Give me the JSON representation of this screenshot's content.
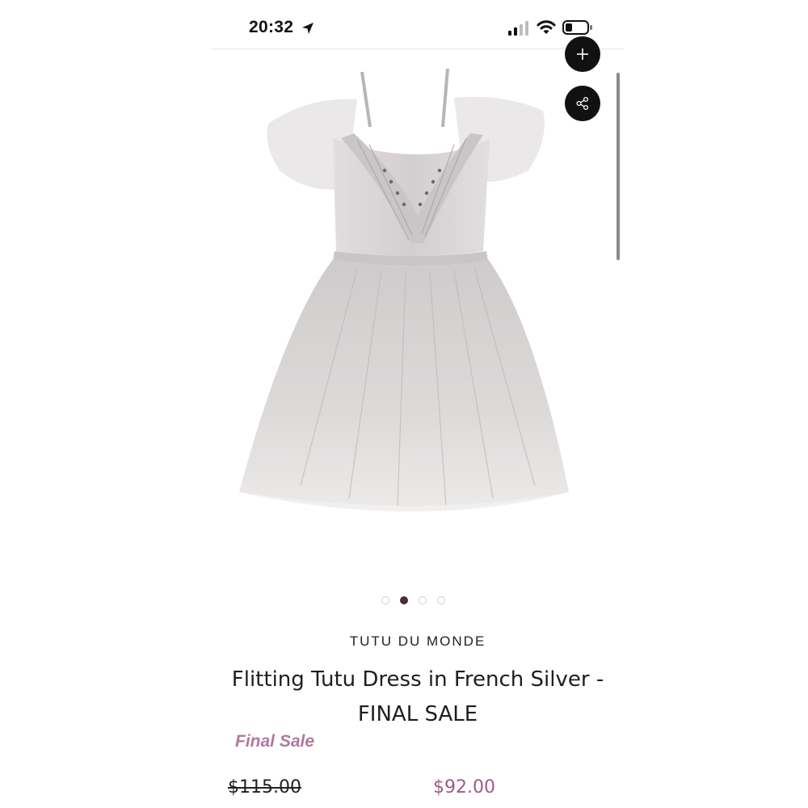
{
  "status_bar": {
    "time": "20:32",
    "icons": [
      "location-arrow-icon",
      "cellular-signal-icon",
      "wifi-icon",
      "battery-icon"
    ]
  },
  "product_media": {
    "image_subject": "grey tulle tutu dress",
    "actions": [
      "plus-icon",
      "share-icon"
    ],
    "carousel": {
      "total": 4,
      "active_index": 1
    }
  },
  "product": {
    "brand": "TUTU DU MONDE",
    "title": "Flitting Tutu Dress in French Silver - FINAL SALE",
    "sale_tag": "Final Sale",
    "original_price": "$115.00",
    "sale_price": "$92.00"
  },
  "colors": {
    "accent_purple": "#a05a86",
    "sale_tag_pink": "#b07a9d",
    "active_dot": "#4a2c3a",
    "button_black": "#111111"
  }
}
